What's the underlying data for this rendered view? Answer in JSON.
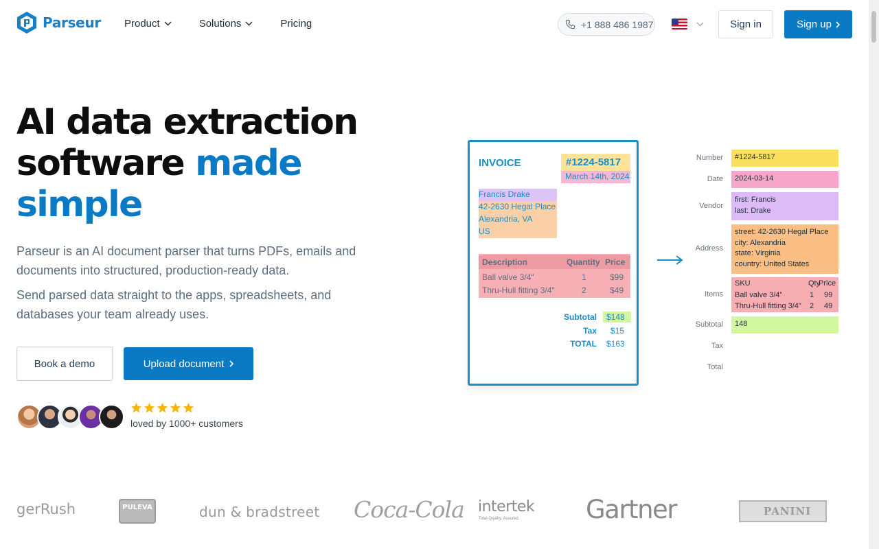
{
  "header": {
    "brand": "Parseur",
    "nav": [
      {
        "label": "Product",
        "has_dropdown": true
      },
      {
        "label": "Solutions",
        "has_dropdown": true
      },
      {
        "label": "Pricing",
        "has_dropdown": false
      }
    ],
    "phone": "+1 888 486 1987",
    "language_flag": "us-flag-icon",
    "signin_label": "Sign in",
    "signup_label": "Sign up"
  },
  "hero": {
    "title_line1": "AI data extraction",
    "title_line2_plain": "software ",
    "title_line2_accent": "made",
    "title_line3_accent": "simple",
    "description1": "Parseur is an AI document parser that turns PDFs, emails and documents into structured, production-ready data.",
    "description2": "Send parsed data straight to the apps, spreadsheets, and databases your team already uses.",
    "demo_button": "Book a demo",
    "upload_button": "Upload document",
    "rating_stars": 5,
    "social_proof": "loved by 1000+ customers"
  },
  "invoice": {
    "title": "INVOICE",
    "number": "#1224-5817",
    "date": "March 14th, 2024",
    "address": [
      "Francis Drake",
      "42-2630 Hegal Place",
      "Alexandria, VA",
      "US"
    ],
    "table_headers": [
      "Description",
      "Quantity",
      "Price"
    ],
    "rows": [
      [
        "Ball valve 3/4\"",
        "1",
        "$99"
      ],
      [
        "Thru-Hull fitting 3/4\"",
        "2",
        "$49"
      ]
    ],
    "subtotal_label": "Subtotal",
    "subtotal": "$148",
    "tax_label": "Tax",
    "tax": "$15",
    "total_label": "TOTAL",
    "total": "$163"
  },
  "extracted": {
    "labels": [
      "Number",
      "Date",
      "Vendor",
      "Address",
      "Items",
      "Subtotal",
      "Tax",
      "Total"
    ],
    "number": "#1224-5817",
    "date": "2024-03-14",
    "vendor": [
      "first: Francis",
      "last: Drake"
    ],
    "address": [
      "street: 42-2630 Hegal Place",
      "city: Alexandria",
      "state: Virginia",
      "country: United States"
    ],
    "items_header": [
      "SKU",
      "Qty",
      "Price"
    ],
    "items": [
      [
        "Ball valve 3/4\"",
        "1",
        "99"
      ],
      [
        "Thru-Hull fitting 3/4\"",
        "2",
        "49"
      ]
    ],
    "subtotal": "148"
  },
  "logos": [
    "gerRush",
    "PULEVA",
    "dun & bradstreet",
    "Coca-Cola",
    "intertek",
    "Total Quality. Assured.",
    "Gartner",
    "PANINI"
  ],
  "colors": {
    "brand_blue": "#0a7ac4",
    "heading": "#0d0d0d",
    "body_text": "#5e6e80"
  }
}
